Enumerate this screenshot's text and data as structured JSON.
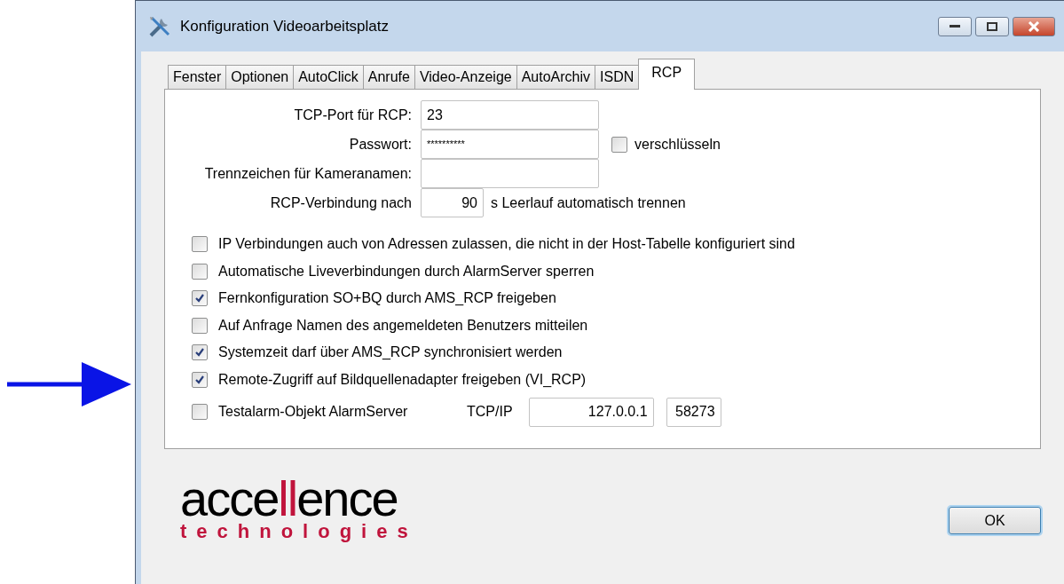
{
  "window": {
    "title": "Konfiguration Videoarbeitsplatz"
  },
  "tabs": [
    {
      "label": "Fenster",
      "selected": false
    },
    {
      "label": "Optionen",
      "selected": false
    },
    {
      "label": "AutoClick",
      "selected": false
    },
    {
      "label": "Anrufe",
      "selected": false
    },
    {
      "label": "Video-Anzeige",
      "selected": false
    },
    {
      "label": "AutoArchiv",
      "selected": false
    },
    {
      "label": "ISDN",
      "selected": false
    },
    {
      "label": "RCP",
      "selected": true
    }
  ],
  "fields": [
    {
      "label": "TCP-Port für RCP:",
      "value": "23"
    },
    {
      "label": "Passwort:",
      "value": "**********",
      "checkbox": {
        "label": "verschlüsseln",
        "checked": false
      }
    },
    {
      "label": "Trennzeichen für Kameranamen:"
    },
    {
      "label": "RCP-Verbindung nach",
      "value": "90",
      "suffix": "s Leerlauf automatisch trennen",
      "kind": "short"
    }
  ],
  "options": [
    {
      "label": "IP Verbindungen auch von Adressen zulassen, die nicht in der Host-Tabelle konfiguriert sind",
      "checked": false
    },
    {
      "label": "Automatische Liveverbindungen durch AlarmServer sperren",
      "checked": false
    },
    {
      "label": "Fernkonfiguration SO+BQ durch AMS_RCP freigeben",
      "checked": true
    },
    {
      "label": "Auf Anfrage Namen des angemeldeten Benutzers mitteilen",
      "checked": false
    },
    {
      "label": "Systemzeit darf über AMS_RCP synchronisiert werden",
      "checked": true
    },
    {
      "label": "Remote-Zugriff auf Bildquellenadapter freigeben (VI_RCP)",
      "checked": true
    }
  ],
  "testalarm": {
    "label": "Testalarm-Objekt AlarmServer",
    "checked": false,
    "address_label": "TCP/IP",
    "address": "127.0.0.1",
    "port": "58273"
  },
  "logo": {
    "parts": [
      {
        "text": "acce",
        "accent": false
      },
      {
        "text": "ll",
        "accent": true
      },
      {
        "text": "ence",
        "accent": false
      }
    ],
    "subtitle": "technologies"
  },
  "buttons": [
    "OK"
  ]
}
